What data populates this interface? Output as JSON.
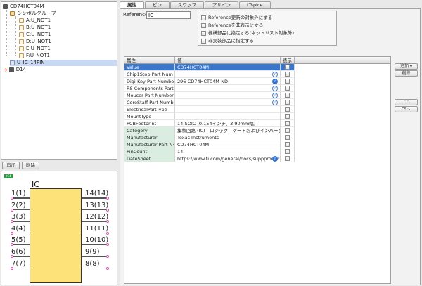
{
  "tree": {
    "root": "CD74HCT04M",
    "group": "シンボルグループ",
    "symbols": [
      "A:U_NOT1",
      "B:U_NOT1",
      "C:U_NOT1",
      "D:U_NOT1",
      "E:U_NOT1",
      "F:U_NOT1"
    ],
    "component": "U_IC_14PIN",
    "other": "D14"
  },
  "left_buttons": {
    "add": "追加",
    "delete": "削除"
  },
  "preview": {
    "badge": "IIC4",
    "title": "IC",
    "left_pins": [
      "1(1)",
      "2(2)",
      "3(3)",
      "4(4)",
      "5(5)",
      "6(6)",
      "7(7)"
    ],
    "right_pins": [
      "14(14)",
      "13(13)",
      "12(12)",
      "11(11)",
      "10(10)",
      "9(9)",
      "8(8)"
    ]
  },
  "tabs": [
    "属性",
    "ピン",
    "スワップ",
    "アサイン",
    "LTspice"
  ],
  "reference": {
    "label": "Reference",
    "value": "IC"
  },
  "options": [
    "Reference更新の対象外にする",
    "Referenceを非表示にする",
    "機構部品に指定する(ネットリスト対象外)",
    "非実装部品に指定する"
  ],
  "grid": {
    "headers": {
      "attribute": "属性",
      "value": "値",
      "display": "表示"
    },
    "rows": [
      {
        "name": "Value",
        "value": "CD74HCT04M",
        "info": "",
        "selected": true,
        "green": false
      },
      {
        "name": "Chip1Stop Part Num···",
        "value": "",
        "info": "i",
        "selected": false,
        "green": false
      },
      {
        "name": "Digi-Key Part Number",
        "value": "296-CD74HCT04M-ND",
        "info": "i",
        "info_filled": true,
        "selected": false,
        "green": false
      },
      {
        "name": "RS Components Part···",
        "value": "",
        "info": "i",
        "selected": false,
        "green": false
      },
      {
        "name": "Mouser Part Number",
        "value": "",
        "info": "i",
        "selected": false,
        "green": false
      },
      {
        "name": "CoreStaff Part Number",
        "value": "",
        "info": "i",
        "selected": false,
        "green": false
      },
      {
        "name": "ElectricalPartType",
        "value": "",
        "info": "",
        "selected": false,
        "green": false
      },
      {
        "name": "MountType",
        "value": "",
        "info": "",
        "selected": false,
        "green": false
      },
      {
        "name": "PCBFootprint",
        "value": "14-SOIC (0.154インチ、3.90mm幅)",
        "info": "",
        "selected": false,
        "green": false
      },
      {
        "name": "Category",
        "value": "集積回路 (IC) - ロジック - ゲートおよびインバータ",
        "info": "",
        "selected": false,
        "green": true
      },
      {
        "name": "Manufacturer",
        "value": "Texas Instruments",
        "info": "",
        "selected": false,
        "green": true
      },
      {
        "name": "Manufacturer Part N···",
        "value": "CD74HCT04M",
        "info": "",
        "selected": false,
        "green": true
      },
      {
        "name": "PinCount",
        "value": "14",
        "info": "",
        "selected": false,
        "green": true
      },
      {
        "name": "DateSheet",
        "value": "https://www.ti.com/general/docs/suppproductinfo",
        "info": "i",
        "info_filled": true,
        "selected": false,
        "green": true
      }
    ]
  },
  "side_buttons": {
    "add": "追加 ▾",
    "delete": "削除",
    "up": "上へ",
    "down": "下へ"
  }
}
